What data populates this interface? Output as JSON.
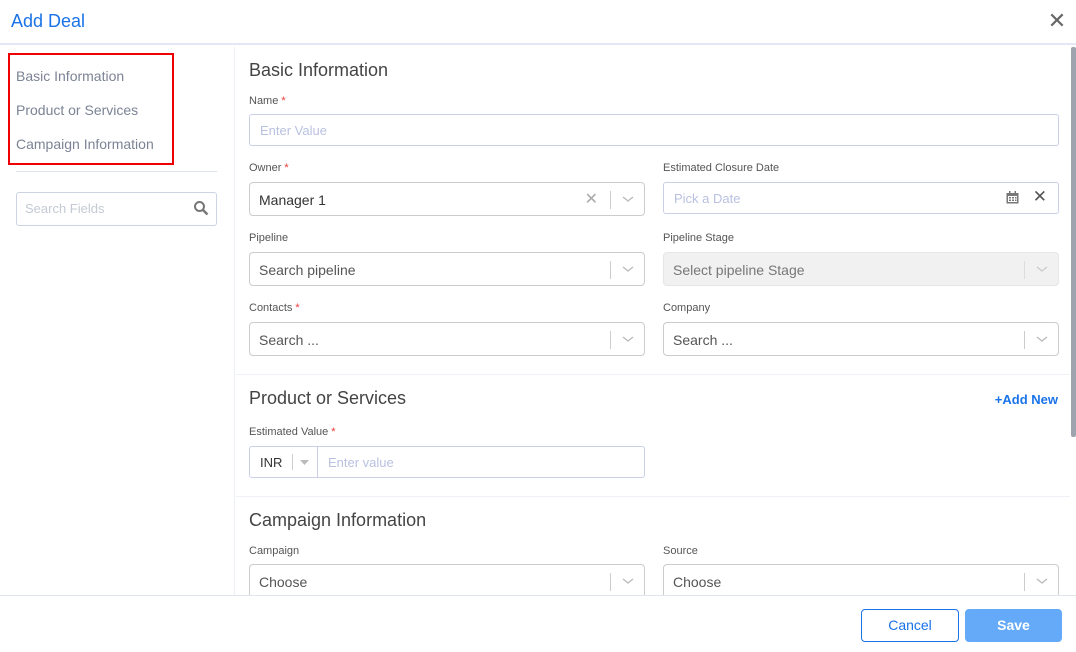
{
  "header": {
    "title": "Add Deal",
    "close_icon": "close-icon"
  },
  "sidebar": {
    "nav": [
      {
        "label": "Basic Information"
      },
      {
        "label": "Product or Services"
      },
      {
        "label": "Campaign Information"
      }
    ],
    "search_placeholder": "Search Fields"
  },
  "basic": {
    "title": "Basic Information",
    "name_label": "Name",
    "name_placeholder": "Enter Value",
    "owner_label": "Owner",
    "owner_value": "Manager 1",
    "closure_label": "Estimated Closure Date",
    "closure_placeholder": "Pick a Date",
    "pipeline_label": "Pipeline",
    "pipeline_placeholder": "Search pipeline",
    "stage_label": "Pipeline Stage",
    "stage_placeholder": "Select pipeline Stage",
    "contacts_label": "Contacts",
    "contacts_placeholder": "Search ...",
    "company_label": "Company",
    "company_placeholder": "Search ..."
  },
  "product": {
    "title": "Product or Services",
    "add_new": "+Add New",
    "value_label": "Estimated Value",
    "currency": "INR",
    "value_placeholder": "Enter value"
  },
  "campaign": {
    "title": "Campaign Information",
    "campaign_label": "Campaign",
    "campaign_placeholder": "Choose",
    "source_label": "Source",
    "source_placeholder": "Choose"
  },
  "required_mark": "*",
  "footer": {
    "cancel": "Cancel",
    "save": "Save"
  },
  "colors": {
    "accent": "#1a73e8",
    "save": "#64aaf8",
    "highlight": "#e00000"
  }
}
